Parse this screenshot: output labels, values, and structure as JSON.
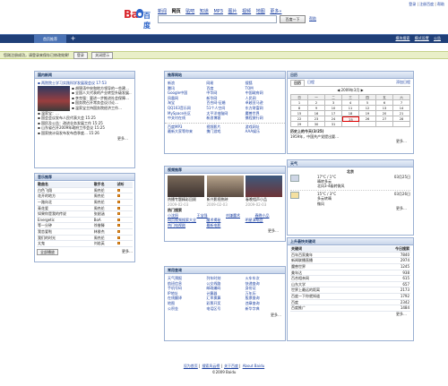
{
  "top_links": [
    "登录",
    "注册百度",
    "帮助"
  ],
  "logo": {
    "text_a": "Bai",
    "text_b": "百度",
    "alt": "Baidu logo"
  },
  "nav": [
    "新闻",
    "网页",
    "贴吧",
    "知道",
    "MP3",
    "图片",
    "视频",
    "地图",
    "更多»"
  ],
  "nav_current": 1,
  "search": {
    "value": "",
    "button": "百度一下",
    "help": "帮助"
  },
  "tabbar": {
    "tab": "首页推荐",
    "add": "+",
    "links": [
      "模块搜索",
      "模式设置",
      "公告"
    ]
  },
  "notice": {
    "text": "您刚注册成功，请登录来保存已修改效果!",
    "btn1": "登录",
    "btn2": "关闭提示"
  },
  "news": {
    "title": "国内新闻",
    "headline": "▪ 两院院士学习实践科学发展观会议 17:53",
    "items": [
      "▪ 胡锦涛中央和地方领导的一些建…",
      "▪ 全国人大代表的产业转型升级发展…",
      "▪ 李克强：要进一步推进社会保障…",
      "▪ 国务院召开常务会议讨论…",
      "▪ 温家宝主持国务院经济工作…",
      "▪ 温家宝：…",
      "▪ 国会会议发布人民代表大会 15:25",
      "▪ 国民及公告：改进业务发展工作 15:25",
      "▪ 山东省召开2009年政府工作会议 15:25",
      "▪ 国家统计局发布发布首季度… 15:26"
    ],
    "more": "更多…"
  },
  "songs": {
    "title": "音乐推荐",
    "headers": [
      "歌曲名",
      "歌手名",
      "试听"
    ],
    "rows": [
      [
        "白色飞翔",
        "周杰伦"
      ],
      [
        "花开的地方",
        "周杰伦"
      ],
      [
        "一路向北",
        "周杰伦"
      ],
      [
        "青花瓷",
        "周杰伦"
      ],
      [
        "如果你是我的传说",
        "张韶涵"
      ],
      [
        "Energetic",
        "BoA"
      ],
      [
        "等一分钟",
        "徐誉滕"
      ],
      [
        "我恋爱啦",
        "林俊杰"
      ],
      [
        "我们的时光",
        "周杰伦"
      ],
      [
        "太鬼",
        "刘若英"
      ]
    ],
    "play_all": "全部播放",
    "more": "更多…"
  },
  "sites": {
    "title": "推荐网站",
    "items": [
      "新浪",
      "网易",
      "搜狐",
      "腾讯",
      "百度",
      "TOM",
      "Google中国",
      "中华网",
      "中国政府网",
      "凤凰网",
      "新华网",
      "人民网",
      "淘宝",
      "百合网·征婚",
      "卓越亚马逊",
      "QQ163音乐网",
      "51个人空间",
      "东方财富网",
      "MySpace社区",
      "太平洋电脑网",
      "魔兽世界",
      "中关村在线",
      "新浪博客",
      "携程旅行网"
    ],
    "extra": [
      "百度MP3",
      "视频影片",
      "游戏网址",
      "最新大家等你来",
      "携门游戏",
      "AAA娱乐"
    ]
  },
  "videos": {
    "title": "视频推荐",
    "items": [
      {
        "caption": "热播专题精彩回顾",
        "time": "2009-02-03"
      },
      {
        "caption": "新兴影视热映",
        "time": "2009-02-03"
      },
      {
        "caption": "春晚相声小品",
        "time": "2009-02-03"
      }
    ],
    "hot_label": "热门搜索",
    "hot": [
      "小沈阳",
      "王宝强",
      "刘谦魔术",
      "春晚小品"
    ],
    "links": [
      "网页视频搜索大全",
      "魔术揭秘",
      "明星演唱会",
      "热门电视剧",
      "最新电影"
    ],
    "more": "更多…"
  },
  "tools": {
    "title": "常用查询",
    "items": [
      "天气预报",
      "列车时刻",
      "火车车次",
      "航班信息",
      "公交线路",
      "快递查询",
      "手机号码",
      "邮政编码",
      "身份证",
      "IP地址",
      "计算器",
      "万年历",
      "在线翻译",
      "汇率换算",
      "股票查询",
      "地图",
      "彩票开奖",
      "违章查询",
      "公积金",
      "电话区号",
      "新华字典"
    ],
    "more": "更多…"
  },
  "calendar": {
    "title": "日历",
    "tabs": [
      "日历",
      "日程"
    ],
    "add": "添加日程",
    "month_label": "2009年3月",
    "weekdays": [
      "日",
      "一",
      "二",
      "三",
      "四",
      "五",
      "六"
    ],
    "days": [
      "1",
      "2",
      "3",
      "4",
      "5",
      "6",
      "7",
      "8",
      "9",
      "10",
      "11",
      "12",
      "13",
      "14",
      "15",
      "16",
      "17",
      "18",
      "19",
      "20",
      "21",
      "22",
      "23",
      "24",
      "25",
      "26",
      "27",
      "28",
      "29",
      "30",
      "31",
      "",
      "",
      "",
      ""
    ],
    "today": "25",
    "history_label": "历史上的今天(3/25)",
    "history_text": "1959年，中国共产党提出要…",
    "more": "更多…"
  },
  "weather": {
    "title": "天气",
    "city": "北京",
    "days": [
      {
        "temp": "17°C / 1°C",
        "desc": "晴转多云",
        "wind": "北风3-4级转微风",
        "date": "03月25日"
      },
      {
        "temp": "15°C / 3°C",
        "desc": "多云转晴",
        "wind": "微风",
        "date": "03月26日"
      }
    ],
    "more": "更多…"
  },
  "hotsearch": {
    "title": "上升最快关键词",
    "headers": [
      "关键词",
      "今日搜索"
    ],
    "rows": [
      [
        "百年百家美年",
        "7840"
      ],
      [
        "新闻联播直播",
        "2974"
      ],
      [
        "魔兽世界",
        "1245"
      ],
      [
        "美年达",
        "938"
      ],
      [
        "百合相亲网",
        "615"
      ],
      [
        "山东大学",
        "657"
      ],
      [
        "世界上最远的距离",
        "2173"
      ],
      [
        "百度一下你就知道",
        "1792"
      ],
      [
        "百度",
        "2342"
      ],
      [
        "百度推广",
        "1484"
      ]
    ],
    "more": "更多…"
  },
  "footer": {
    "links": [
      "设为首页",
      "搜索风云榜",
      "关于百度",
      "About Baidu"
    ],
    "copy": "©2009 Baidu"
  }
}
